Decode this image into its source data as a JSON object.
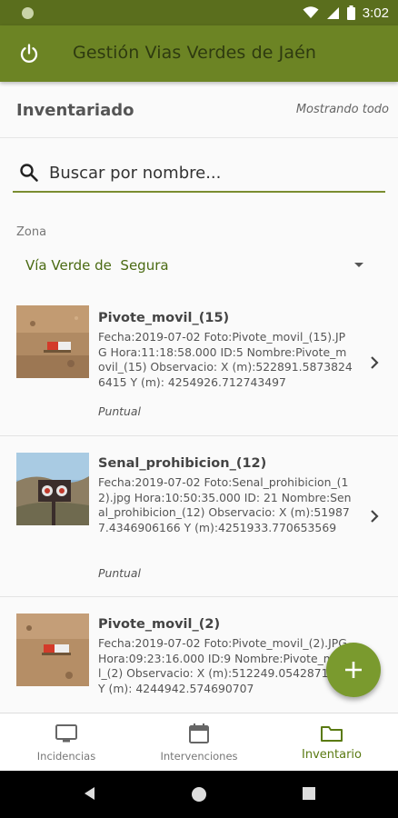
{
  "status_bar": {
    "time": "3:02"
  },
  "app_bar": {
    "title": "Gestión Vias Verdes de Jaén",
    "power_icon": "power-icon"
  },
  "section": {
    "title": "Inventariado",
    "filter_text": "Mostrando todo"
  },
  "search": {
    "placeholder": "Buscar por nombre...",
    "value": ""
  },
  "zone": {
    "label": "Zona",
    "selected": "Vía Verde de  Segura"
  },
  "items": [
    {
      "title": "Pivote_movil_(15)",
      "detail": "Fecha:2019-07-02    Foto:Pivote_movil_(15).JPG   Hora:11:18:58.000   ID:5  Nombre:Pivote_movil_(15)   Observacio: X (m):522891.58738246415   Y (m): 4254926.712743497",
      "type": "Puntual"
    },
    {
      "title": "Senal_prohibicion_(12)",
      "detail": "Fecha:2019-07-02 Foto:Senal_prohibicion_(12).jpg Hora:10:50:35.000    ID: 21    Nombre:Senal_prohibicion_(12) Observacio:     X (m):519877.4346906166 Y (m):4251933.770653569",
      "type": "Puntual"
    },
    {
      "title": "Pivote_movil_(2)",
      "detail": "Fecha:2019-07-02    Foto:Pivote_movil_(2).JPG   Hora:09:23:16.000   ID:9  Nombre:Pivote_movil_(2)   Observacio: X (m):512249.0542871031   Y (m): 4244942.574690707",
      "type": ""
    }
  ],
  "fab": {
    "icon": "plus-icon"
  },
  "bottom_nav": [
    {
      "label": "Incidencias",
      "icon": "monitor-icon"
    },
    {
      "label": "Intervenciones",
      "icon": "calendar-icon"
    },
    {
      "label": "Inventario",
      "icon": "folder-icon"
    }
  ],
  "colors": {
    "primary": "#6c8424",
    "status_bar": "#5a6e1d",
    "accent": "#7a9a2e"
  }
}
